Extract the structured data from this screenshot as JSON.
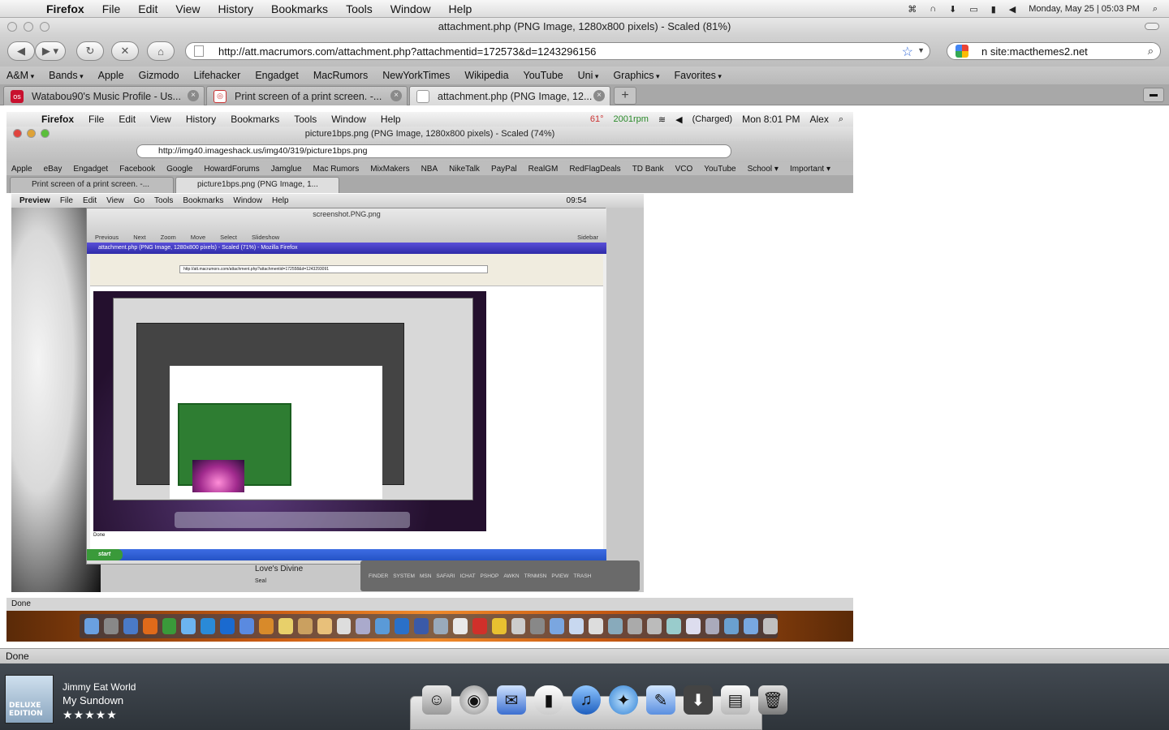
{
  "menubar": {
    "app": "Firefox",
    "items": [
      "File",
      "Edit",
      "View",
      "History",
      "Bookmarks",
      "Tools",
      "Window",
      "Help"
    ],
    "datetime": "Monday, May 25 | 05:03 PM"
  },
  "window": {
    "title": "attachment.php (PNG Image, 1280x800 pixels) - Scaled (81%)"
  },
  "toolbar": {
    "url": "http://att.macrumors.com/attachment.php?attachmentid=172573&d=1243296156",
    "search": "n site:macthemes2.net"
  },
  "bookmarks": [
    {
      "label": "A&M",
      "drop": true
    },
    {
      "label": "Bands",
      "drop": true
    },
    {
      "label": "Apple",
      "drop": false
    },
    {
      "label": "Gizmodo",
      "drop": false
    },
    {
      "label": "Lifehacker",
      "drop": false
    },
    {
      "label": "Engadget",
      "drop": false
    },
    {
      "label": "MacRumors",
      "drop": false
    },
    {
      "label": "NewYorkTimes",
      "drop": false
    },
    {
      "label": "Wikipedia",
      "drop": false
    },
    {
      "label": "YouTube",
      "drop": false
    },
    {
      "label": "Uni",
      "drop": true
    },
    {
      "label": "Graphics",
      "drop": true
    },
    {
      "label": "Favorites",
      "drop": true
    }
  ],
  "tabs": [
    {
      "label": "Watabou90's Music Profile - Us...",
      "icon": "lastfm-icon",
      "active": false
    },
    {
      "label": "Print screen of a print screen. -...",
      "icon": "forum-icon",
      "active": false
    },
    {
      "label": "attachment.php (PNG Image, 12...",
      "icon": "page-icon",
      "active": true
    }
  ],
  "screenshot": {
    "menu_app": "Firefox",
    "menu_items": [
      "File",
      "Edit",
      "View",
      "History",
      "Bookmarks",
      "Tools",
      "Window",
      "Help"
    ],
    "menu_status": [
      "61°",
      "2001rpm",
      "(Charged)",
      "Mon 8:01 PM",
      "Alex"
    ],
    "title": "picture1bps.png (PNG Image, 1280x800 pixels) - Scaled (74%)",
    "url": "http://img40.imageshack.us/img40/319/picture1bps.png",
    "bookmarks": [
      "Apple",
      "eBay",
      "Engadget",
      "Facebook",
      "Google",
      "HowardForums",
      "Jamglue",
      "Mac Rumors",
      "MixMakers",
      "NBA",
      "NikeTalk",
      "PayPal",
      "RealGM",
      "RedFlagDeals",
      "TD Bank",
      "VCO",
      "YouTube",
      "School ▾",
      "Important ▾"
    ],
    "tabs": [
      "Print screen of a print screen. -...",
      "picture1bps.png (PNG Image, 1..."
    ],
    "preview": {
      "menu": [
        "Preview",
        "File",
        "Edit",
        "View",
        "Go",
        "Tools",
        "Bookmarks",
        "Window",
        "Help"
      ],
      "clock": "09:54",
      "title": "screenshot.PNG.png",
      "toolbar_labels": [
        "Previous",
        "Next",
        "Zoom",
        "Move",
        "Select",
        "Slideshow"
      ],
      "sidebar_label": "Sidebar",
      "xp_title": "attachment.php (PNG Image, 1280x800 pixels) - Scaled (71%) - Mozilla Firefox",
      "xp_url": "http://att.macrumors.com/attachment.php?attachmentid=172558&d=1243293091",
      "xp_done": "Done",
      "xp_start": "start",
      "track_name": "Love's Divine",
      "track_artist": "Seal",
      "dock_labels": [
        "FINDER",
        "SYSTEM",
        "MSN",
        "SAFARI",
        "ICHAT",
        "PSHOP",
        "AWKN",
        "TRNMSN",
        "PVIEW",
        "TRASH"
      ]
    },
    "status": "Done"
  },
  "status": "Done",
  "now_playing": {
    "artist": "Jimmy Eat World",
    "song": "My Sundown",
    "rating_stars": 5,
    "stars": "★★★★★",
    "album_text": "DELUXE EDITION"
  },
  "dock_icons": [
    "finder-icon",
    "dashboard-icon",
    "mail-icon",
    "system-icon",
    "itunes-icon",
    "safari-icon",
    "pen-icon",
    "downloads-icon",
    "documents-icon",
    "trash-icon"
  ]
}
